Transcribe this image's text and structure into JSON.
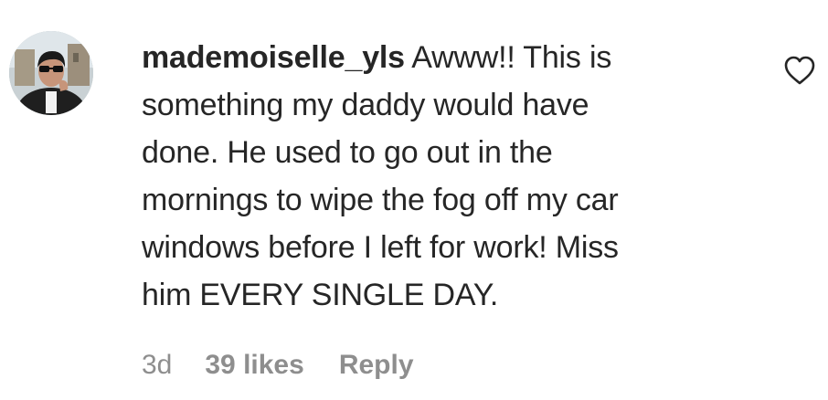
{
  "comment": {
    "username": "mademoiselle_yls",
    "text": "Awww!! This is\nsomething my daddy would have\ndone. He used to go out in the\nmornings to wipe the fog off my car\nwindows before I left for work! Miss\nhim EVERY SINGLE DAY.",
    "time": "3d",
    "likes": "39 likes",
    "reply_label": "Reply"
  },
  "icons": {
    "avatar": "profile-photo",
    "like": "heart-outline-icon"
  },
  "colors": {
    "text": "#262626",
    "secondary": "#8e8e8e",
    "background": "#ffffff"
  }
}
